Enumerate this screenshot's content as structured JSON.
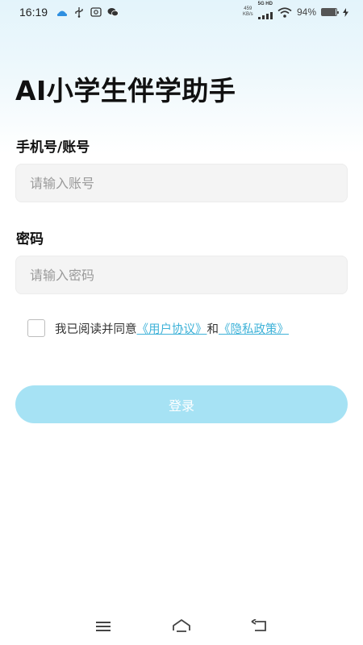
{
  "status_bar": {
    "time": "16:19",
    "net_speed_value": "459",
    "net_speed_unit": "KB/s",
    "network_badge": "5G HD",
    "battery_percent": "94%",
    "battery_level": 0.94,
    "icons": [
      "baidu-netdisk-icon",
      "usb-icon",
      "screenshot-icon",
      "wechat-icon",
      "signal-icon",
      "wifi-icon",
      "battery-icon",
      "charging-icon"
    ]
  },
  "app": {
    "title": "AI小学生伴学助手"
  },
  "form": {
    "account_label": "手机号/账号",
    "account_placeholder": "请输入账号",
    "account_value": "",
    "password_label": "密码",
    "password_placeholder": "请输入密码",
    "password_value": ""
  },
  "agreement": {
    "checked": false,
    "prefix": "我已阅读并同意",
    "user_agreement": "《用户协议》",
    "conjunction": "和",
    "privacy_policy": "《隐私政策》"
  },
  "login": {
    "label": "登录"
  },
  "colors": {
    "accent": "#3eb2d8",
    "button_bg": "#a6e2f4",
    "input_bg": "#f4f4f4"
  },
  "nav_bar": {
    "icons": [
      "menu-icon",
      "home-icon",
      "back-icon"
    ]
  }
}
